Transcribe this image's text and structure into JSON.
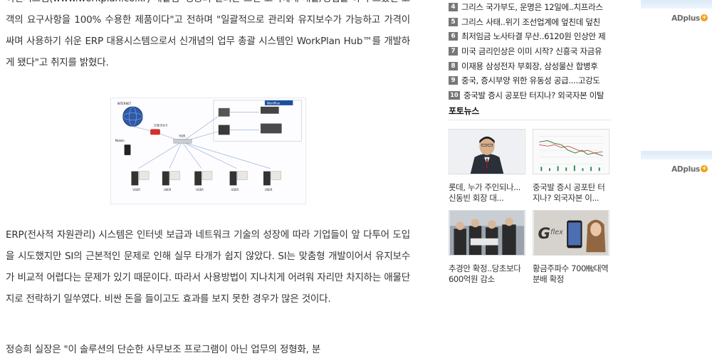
{
  "article": {
    "para1": "이컨시스템(www.workplan.co.kr) 개발팀 '성공의 열쇠는 그런 고객에게 개발/영업을 하며 느꼈던 고객의 요구사항을 100% 수용한 제품이다\"고 전하며 \"일괄적으로 관리와 유지보수가 가능하고 가격이 싸며 사용하기 쉬운 ERP 대용시스템으로서 신개념의 업무 총괄 시스템인 WorkPlan Hub™를 개발하게 됐다\"고 취지를 밝혔다.",
    "para2": "ERP(전사적 자원관리) 시스템은 인터넷 보급과 네트워크 기술의 성장에 따라 기업들이 앞 다투어 도입을 시도했지만 SI의 근본적인 문제로 인해 실무 타개가 쉽지 않았다. SI는 맞춤형 개발이어서 유지보수가 비교적 어렵다는 문제가 있기 때문이다. 따라서 사용방법이 지나치게 어려워 자리만 차지하는 애물단지로 전락하기 일쑤였다. 비싼 돈을 들이고도 효과를 보지 못한 경우가 많은 것이다.",
    "para3": "정승희 실장은 \"이 솔루션의 단순한 사무보조 프로그램이 아닌 업무의 정형화, 분"
  },
  "diagram": {
    "internet": "INTERNET",
    "mobile": "Mobile",
    "modem": "모뎀/공유기",
    "hub": "HUB",
    "brand": "WorkPlan",
    "users": [
      "USER",
      "USER",
      "USER",
      "USER",
      "USER"
    ]
  },
  "rankings": [
    {
      "num": "4",
      "title": "그리스 국가부도, 운명은 12일에..치프라스"
    },
    {
      "num": "5",
      "title": "그리스 사태..위기 조선업계에 엎친데 덮친"
    },
    {
      "num": "6",
      "title": "최저임금 노사타결 무산..6120원 인상안 제"
    },
    {
      "num": "7",
      "title": "미국 금리인상은 이미 시작? 신흥국 자금유"
    },
    {
      "num": "8",
      "title": "이재용 삼성전자 부회장, 삼성물산 합병후"
    },
    {
      "num": "9",
      "title": "중국, 증시부양 위한 유동성 공급....고강도"
    },
    {
      "num": "10",
      "title": "중국발 증시 공포탄 터지나? 외국자본 이탈"
    }
  ],
  "photo_news": {
    "heading": "포토뉴스",
    "items": [
      {
        "caption": "롯데, 누가 주인되나...신동빈 회장 대..."
      },
      {
        "caption": "중국발 증시 공포탄 터지나? 외국자본 이..."
      },
      {
        "caption": "추경안 확정..당초보다 600억원 감소"
      },
      {
        "caption": "황금주파수 700㎒대역 분배 확정"
      }
    ]
  },
  "ads": [
    {
      "label": "ADplus",
      "plus": "+"
    },
    {
      "label": "ADplus",
      "plus": "+"
    }
  ]
}
